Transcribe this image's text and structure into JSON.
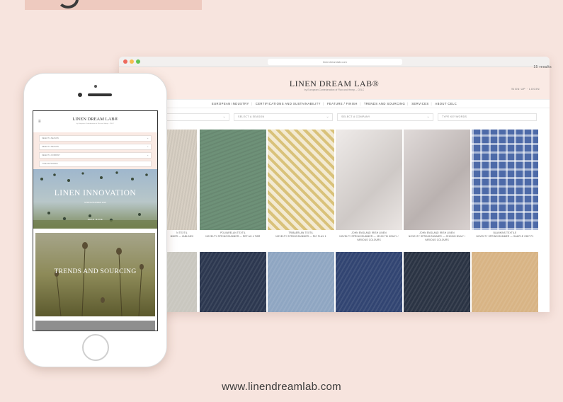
{
  "browser": {
    "url": "linendreamlab.com",
    "logo": "LINEN DREAM LAB®",
    "logo_sub": "by European Confederation of Flax and Hemp – CELC",
    "signup": "SIGN UP · LOGIN",
    "nav": [
      "EUROPEAN INDUSTRY",
      "CERTIFICATIONS AND SUSTAINABILITY",
      "FEATURE / FINISH",
      "TRENDS AND SOURCING",
      "SERVICES",
      "ABOUT CELC"
    ],
    "filters": [
      "",
      "SELECT A SEASON",
      "SELECT A COMPANY",
      "TYPE KEYWORDS"
    ],
    "results": "15 results",
    "products": [
      {
        "color": "#d8d0c4",
        "caption1": "N TEXTIL",
        "caption2": "MMER — JABLINEX"
      },
      {
        "color": "#6e9178",
        "caption1": "POLVARELAN TEXTIL",
        "caption2": "NOVELTY SPRING/SUMMER — REF AH 4 TWR"
      },
      {
        "color": "#e7d7a9",
        "caption1": "TRIBAERLAN TEXTIL",
        "caption2": "NOVELTY SPRING/SUMMER — RIC FLAX 1"
      },
      {
        "color": "#e6e0dd",
        "caption1": "JOHN ENGLAND IRISH LINEN",
        "caption2": "NOVELTY SPRING/SUMMER — JE100 TM HEAVY / VARIOUS COLOURS"
      },
      {
        "color": "#cfc6c4",
        "caption1": "JOHN ENGLAND IRISH LINEN",
        "caption2": "NOVELTY SPRING/SUMMER — JE100M HEAVY / VARIOUS COLOURS"
      },
      {
        "color": "#4d6aa8",
        "caption1": "BLANKINS TEXTILE",
        "caption2": "NOVELTY SPRING/SUMMER — SAMPLE 2387 P1"
      }
    ],
    "products_row2": [
      "#c9c7bf",
      "#2d3850",
      "#8fa6c2",
      "#324572",
      "#2b3444",
      "#d8b485"
    ]
  },
  "phone": {
    "logo": "LINEN DREAM LAB®",
    "logo_sub": "by European Confederation of Flax and Hemp – CELC",
    "menu_icon": "hamburger-icon",
    "filters": [
      "SELECT A SEASON",
      "SELECT A SEASON",
      "SELECT A COMPANY",
      "TYPE KEYWORDS"
    ],
    "hero1_title": "LINEN INNOVATION",
    "hero1_sub": "SPRING/SUMMER 2023",
    "hero1_link": "READ MORE",
    "hero2_title": "TRENDS AND SOURCING"
  },
  "footer": {
    "url": "www.linendreamlab.com"
  },
  "colors": {
    "background": "#f7e4de",
    "accent_tab": "#eecabf"
  }
}
